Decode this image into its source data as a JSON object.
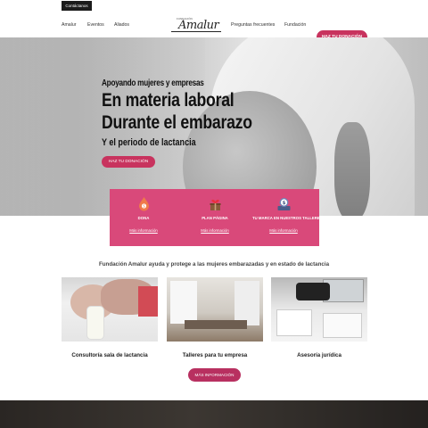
{
  "topbar": {
    "contact_label": "Contáctanos"
  },
  "nav": {
    "left_links": [
      "Amalur",
      "Eventos",
      "Aliados"
    ],
    "logo_small": "FUNDACIÓN",
    "logo_text": "Amalur",
    "right_links": [
      "Preguntas frecuentes",
      "Fundación"
    ],
    "donate_label": "HAZ TU DONACIÓN"
  },
  "hero": {
    "subtitle": "Apoyando mujeres y empresas",
    "headline_1": "En materia laboral",
    "headline_2": "Durante el embarazo",
    "tagline": "Y el periodo de lactancia",
    "button_label": "HAZ TU DONACIÓN"
  },
  "features": [
    {
      "icon": "donation-drop-icon",
      "title": "DONA",
      "link": "Más información"
    },
    {
      "icon": "gift-box-heart-icon",
      "title": "PLAN PÁGINA",
      "link": "Más información"
    },
    {
      "icon": "money-tray-icon",
      "title": "TU MARCA EN NUESTROS TALLERES",
      "link": "Más información"
    }
  ],
  "intro_text": "Fundación Amalur ayuda y protege a las mujeres embarazadas y en estado de lactancia",
  "cards": [
    {
      "caption": "Consultoría sala de lactancia"
    },
    {
      "caption": "Talleres para tu empresa"
    },
    {
      "caption": "Asesoría jurídica"
    }
  ],
  "more_button": "MÁS INFORMACIÓN",
  "colors": {
    "accent": "#c8335e",
    "feature_box": "#d9497a",
    "dark": "#1c1c1c"
  }
}
